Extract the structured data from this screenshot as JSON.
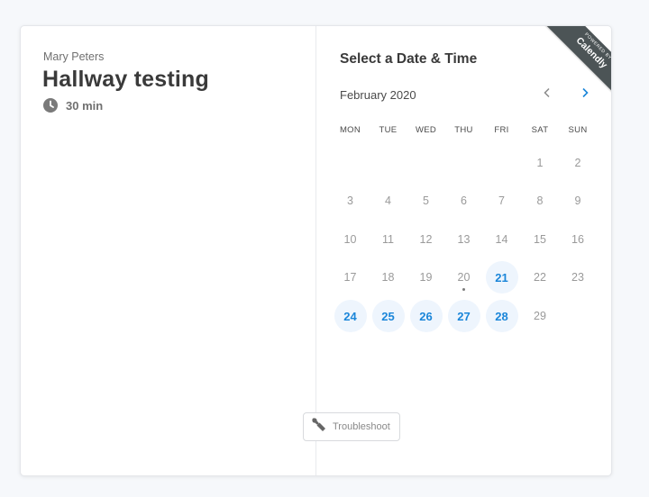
{
  "event": {
    "host": "Mary Peters",
    "title": "Hallway testing",
    "duration": "30 min"
  },
  "calendar": {
    "heading": "Select a Date & Time",
    "month_label": "February 2020",
    "weekdays": [
      "MON",
      "TUE",
      "WED",
      "THU",
      "FRI",
      "SAT",
      "SUN"
    ],
    "first_weekday_index": 5,
    "days_in_month": 29,
    "available_days": [
      21,
      24,
      25,
      26,
      27,
      28
    ],
    "today": 20,
    "accent_color": "#1b86d9"
  },
  "ribbon": {
    "powered_by": "POWERED BY",
    "brand": "Calendly"
  },
  "troubleshoot": {
    "label": "Troubleshoot"
  },
  "icons": {
    "clock": "clock-icon",
    "prev": "chevron-left-icon",
    "next": "chevron-right-icon",
    "wrench": "wrench-icon"
  }
}
